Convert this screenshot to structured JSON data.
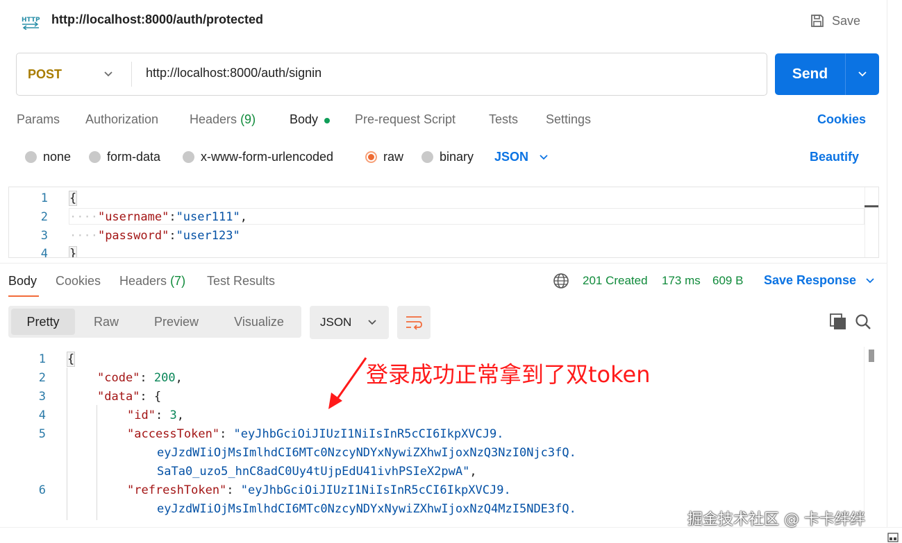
{
  "header": {
    "title": "http://localhost:8000/auth/protected",
    "save_label": "Save",
    "http_icon_text": "HTTP"
  },
  "request": {
    "method": "POST",
    "url": "http://localhost:8000/auth/signin",
    "send_label": "Send",
    "method_color": "#a87c00",
    "accent_color": "#0b73e3"
  },
  "request_tabs": {
    "params": "Params",
    "authorization": "Authorization",
    "headers": "Headers",
    "headers_count": "(9)",
    "body": "Body",
    "prerequest": "Pre-request Script",
    "tests": "Tests",
    "settings": "Settings",
    "cookies": "Cookies"
  },
  "body_types": {
    "none": "none",
    "form_data": "form-data",
    "urlencoded": "x-www-form-urlencoded",
    "raw": "raw",
    "binary": "binary",
    "selected": "raw",
    "language": "JSON",
    "beautify": "Beautify"
  },
  "request_body": {
    "line_numbers": [
      "1",
      "2",
      "3",
      "4"
    ],
    "open_brace": "{",
    "username_key": "\"username\"",
    "username_value": "\"user111\"",
    "password_key": "\"password\"",
    "password_value": "\"user123\"",
    "close_brace": "}"
  },
  "response_tabs": {
    "body": "Body",
    "cookies": "Cookies",
    "headers": "Headers",
    "headers_count": "(7)",
    "test_results": "Test Results"
  },
  "response_meta": {
    "status": "201 Created",
    "time": "173 ms",
    "size": "609 B",
    "save_response": "Save Response",
    "status_color": "#0f8a3a"
  },
  "view_modes": {
    "pretty": "Pretty",
    "raw": "Raw",
    "preview": "Preview",
    "visualize": "Visualize",
    "format": "JSON"
  },
  "response_body": {
    "line_numbers": [
      "1",
      "2",
      "3",
      "4",
      "5",
      "6"
    ],
    "open_brace": "{",
    "code_key": "\"code\"",
    "code_value": "200",
    "data_key": "\"data\"",
    "data_open": "{",
    "id_key": "\"id\"",
    "id_value": "3",
    "access_key": "\"accessToken\"",
    "access_value_1": "\"eyJhbGciOiJIUzI1NiIsInR5cCI6IkpXVCJ9.",
    "access_value_2": "eyJzdWIiOjMsImlhdCI6MTc0NzcyNDYxNywiZXhwIjoxNzQ3NzI0Njc3fQ.",
    "access_value_3": "SaTa0_uzo5_hnC8adC0Uy4tUjpEdU41ivhPSIeX2pwA\"",
    "refresh_key": "\"refreshToken\"",
    "refresh_value_1": "\"eyJhbGciOiJIUzI1NiIsInR5cCI6IkpXVCJ9.",
    "refresh_value_2": "eyJzdWIiOjMsImlhdCI6MTc0NzcyNDYxNywiZXhwIjoxNzQ4MzI5NDE3fQ."
  },
  "annotation": {
    "text": "登录成功正常拿到了双token",
    "color": "#ff1a1a"
  },
  "watermark": "掘金技术社区 @ 卡卡绊绊"
}
